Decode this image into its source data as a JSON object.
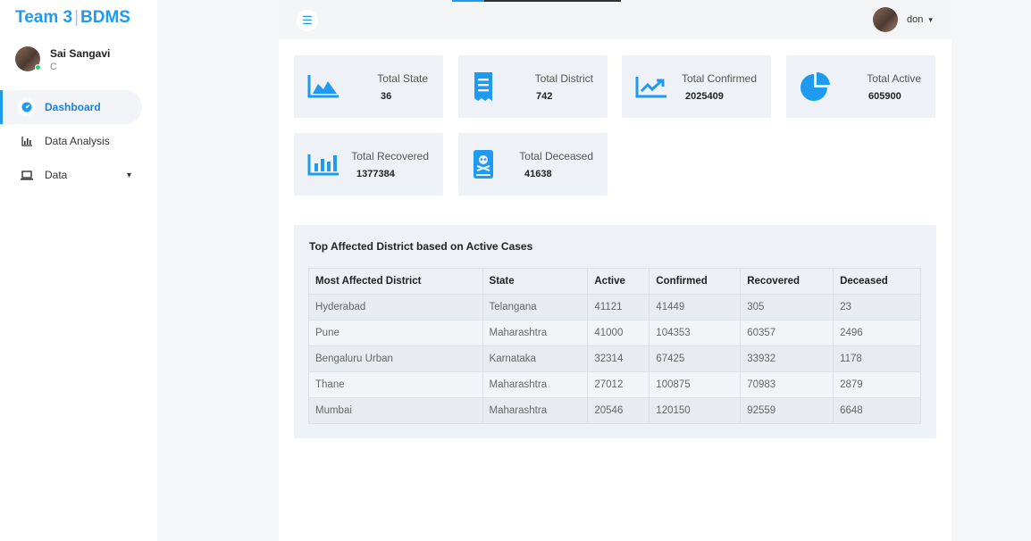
{
  "sidebar": {
    "brand_team": "Team 3",
    "brand_sep": "|",
    "brand_name": "BDMS",
    "user_name": "Sai Sangavi",
    "user_sub": "C",
    "nav": [
      {
        "label": "Dashboard",
        "icon": "dashboard-icon",
        "active": true
      },
      {
        "label": "Data Analysis",
        "icon": "bar-chart-icon",
        "active": false
      },
      {
        "label": "Data",
        "icon": "laptop-icon",
        "active": false
      }
    ]
  },
  "topbar": {
    "menu_icon": "hamburger-icon",
    "user_name": "don"
  },
  "stats": [
    {
      "label": "Total State",
      "value": "36",
      "icon": "area-chart-icon"
    },
    {
      "label": "Total District",
      "value": "742",
      "icon": "receipt-icon"
    },
    {
      "label": "Total Confirmed",
      "value": "2025409",
      "icon": "trend-chart-icon"
    },
    {
      "label": "Total Active",
      "value": "605900",
      "icon": "pie-chart-icon"
    },
    {
      "label": "Total Recovered",
      "value": "1377384",
      "icon": "bar-chart-icon"
    },
    {
      "label": "Total Deceased",
      "value": "41638",
      "icon": "skull-book-icon"
    }
  ],
  "table": {
    "title": "Top Affected District based on Active Cases",
    "headers": [
      "Most Affected District",
      "State",
      "Active",
      "Confirmed",
      "Recovered",
      "Deceased"
    ],
    "rows": [
      [
        "Hyderabad",
        "Telangana",
        "41121",
        "41449",
        "305",
        "23"
      ],
      [
        "Pune",
        "Maharashtra",
        "41000",
        "104353",
        "60357",
        "2496"
      ],
      [
        "Bengaluru Urban",
        "Karnataka",
        "32314",
        "67425",
        "33932",
        "1178"
      ],
      [
        "Thane",
        "Maharashtra",
        "27012",
        "100875",
        "70983",
        "2879"
      ],
      [
        "Mumbai",
        "Maharashtra",
        "20546",
        "120150",
        "92559",
        "6648"
      ]
    ]
  },
  "colors": {
    "accent": "#1e9bf0",
    "panel": "#eef1f5"
  }
}
